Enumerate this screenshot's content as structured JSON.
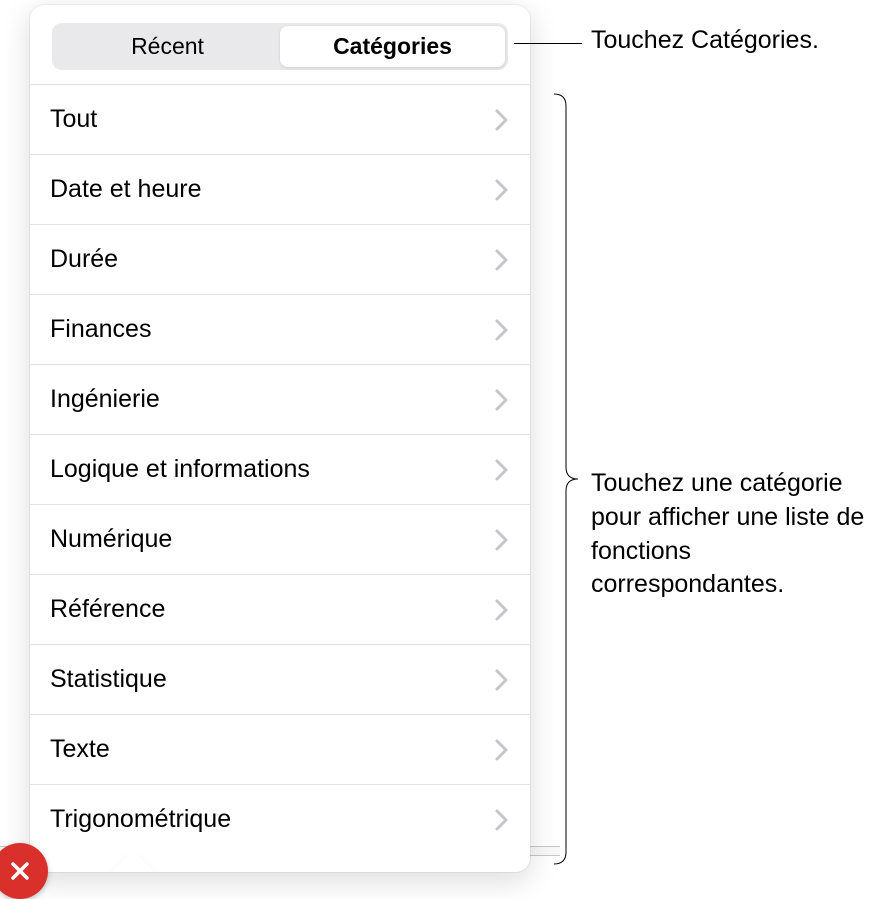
{
  "segmented": {
    "recent": "Récent",
    "categories": "Catégories"
  },
  "categories": {
    "items": [
      {
        "label": "Tout"
      },
      {
        "label": "Date et heure"
      },
      {
        "label": "Durée"
      },
      {
        "label": "Finances"
      },
      {
        "label": "Ingénierie"
      },
      {
        "label": "Logique et informations"
      },
      {
        "label": "Numérique"
      },
      {
        "label": "Référence"
      },
      {
        "label": "Statistique"
      },
      {
        "label": "Texte"
      },
      {
        "label": "Trigonométrique"
      }
    ]
  },
  "callouts": {
    "top": "Touchez Catégories.",
    "list": "Touchez une catégorie pour afficher une liste de fonctions correspondantes."
  }
}
